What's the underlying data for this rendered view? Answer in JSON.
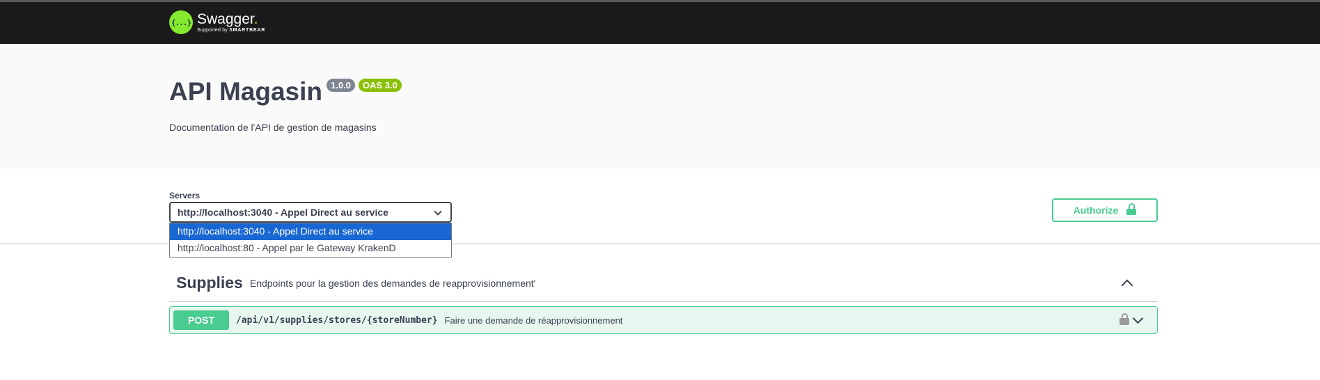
{
  "topbar": {
    "logo_glyph": "{...}",
    "logo_name": "Swagger",
    "logo_dot": ".",
    "logo_supported": "Supported by",
    "logo_company": "SMARTBEAR"
  },
  "info": {
    "title": "API Magasin",
    "version": "1.0.0",
    "oas": "OAS 3.0",
    "description": "Documentation de l'API de gestion de magasins"
  },
  "servers": {
    "label": "Servers",
    "selected": "http://localhost:3040 - Appel Direct au service",
    "options": [
      "http://localhost:3040 - Appel Direct au service",
      "http://localhost:80 - Appel par le Gateway KrakenD"
    ]
  },
  "authorize": {
    "label": "Authorize",
    "icon": "lock-icon"
  },
  "tags": [
    {
      "name": "Supplies",
      "description": "Endpoints pour la gestion des demandes de reapprovisionnement'",
      "expanded": true,
      "operations": [
        {
          "method": "POST",
          "path": "/api/v1/supplies/stores/{storeNumber}",
          "summary": "Faire une demande de réapprovisionnement"
        }
      ]
    }
  ],
  "colors": {
    "topbar": "#1b1b1b",
    "brand_green": "#85ea2d",
    "post_green": "#49cc90",
    "version_badge": "#7d8492",
    "oas_badge": "#89bf04",
    "selected_option": "#1967d2"
  }
}
